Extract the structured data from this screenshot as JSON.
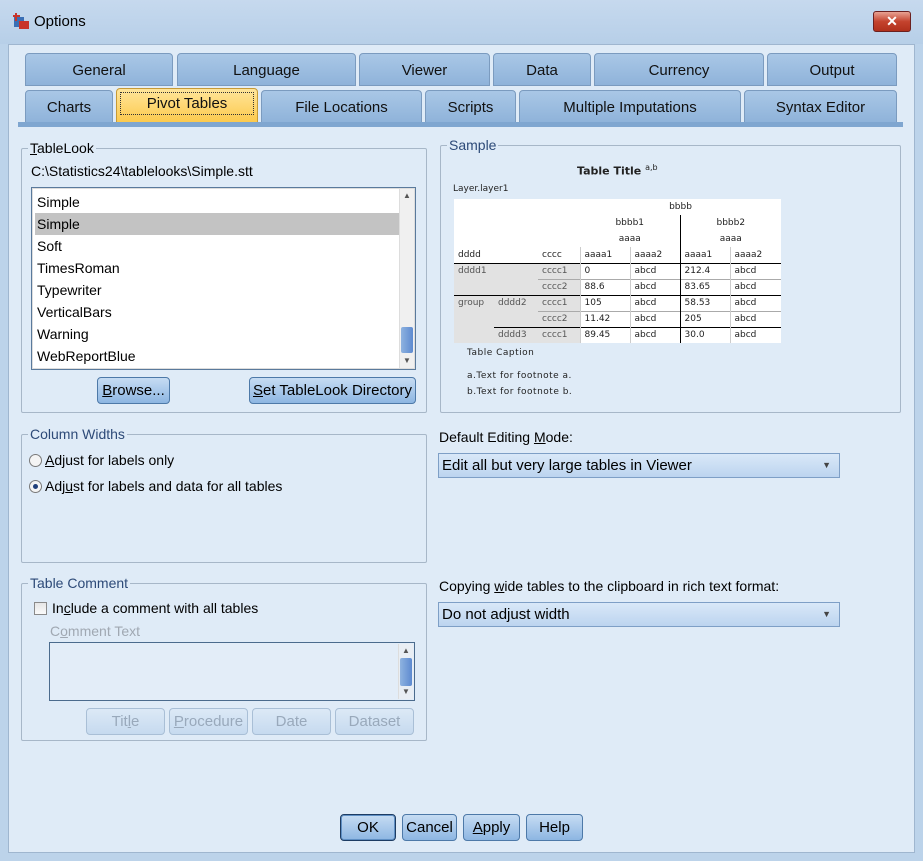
{
  "window": {
    "title": "Options",
    "close": "✕"
  },
  "tabs_row1": [
    "General",
    "Language",
    "Viewer",
    "Data",
    "Currency",
    "Output"
  ],
  "tabs_row2": [
    "Charts",
    "Pivot Tables",
    "File Locations",
    "Scripts",
    "Multiple Imputations",
    "Syntax Editor"
  ],
  "active_tab": "Pivot Tables",
  "tablelook": {
    "legend_pre": "",
    "legend_u": "T",
    "legend_post": "ableLook",
    "path": "C:\\Statistics24\\tablelooks\\Simple.stt",
    "items": [
      "Simple",
      "Simple",
      "Soft",
      "TimesRoman",
      "Typewriter",
      "VerticalBars",
      "Warning",
      "WebReportBlue"
    ],
    "selected_index": 1,
    "browse_u": "B",
    "browse_rest": "rowse...",
    "setdir_u": "S",
    "setdir_rest": "et TableLook Directory"
  },
  "sample": {
    "legend": "Sample",
    "title": "Table Title",
    "title_sup": "a,b",
    "layer": "Layer.layer1",
    "col_top": "bbbb",
    "col_b1": "bbbb1",
    "col_b2": "bbbb2",
    "col_a": "aaaa",
    "row_dim": "dddd",
    "row_sub": "cccc",
    "col_leaves": [
      "aaaa1",
      "aaaa2",
      "aaaa1",
      "aaaa2"
    ],
    "rows": [
      {
        "d1": "dddd1",
        "d2": "",
        "c": "cccc1",
        "v": [
          "0",
          "abcd",
          "212.4",
          "abcd"
        ]
      },
      {
        "d1": "",
        "d2": "",
        "c": "cccc2",
        "v": [
          "88.6",
          "abcd",
          "83.65",
          "abcd"
        ]
      },
      {
        "d1": "group",
        "d2": "dddd2",
        "c": "cccc1",
        "v": [
          "105",
          "abcd",
          "58.53",
          "abcd"
        ]
      },
      {
        "d1": "",
        "d2": "",
        "c": "cccc2",
        "v": [
          "11.42",
          "abcd",
          "205",
          "abcd"
        ]
      },
      {
        "d1": "",
        "d2": "dddd3",
        "c": "cccc1",
        "v": [
          "89.45",
          "abcd",
          "30.0",
          "abcd"
        ]
      }
    ],
    "caption": "Table Caption",
    "footnotes": [
      "a.Text for footnote a.",
      "b.Text for footnote b."
    ]
  },
  "column_widths": {
    "legend": "Column Widths",
    "opt1_pre": "",
    "opt1_u": "A",
    "opt1_post": "djust for labels only",
    "opt2_pre": "Adj",
    "opt2_u": "u",
    "opt2_post": "st for labels and data for all tables",
    "selected": 2
  },
  "editing": {
    "label_pre": "Default Editing ",
    "label_u": "M",
    "label_post": "ode:",
    "value": "Edit all but very large tables in Viewer"
  },
  "copying": {
    "label_pre": "Copying ",
    "label_u": "w",
    "label_post": "ide tables to the clipboard in rich text format:",
    "value": "Do not adjust width"
  },
  "table_comment": {
    "legend": "Table Comment",
    "check_pre": "In",
    "check_u": "c",
    "check_post": "lude a comment with all tables",
    "checked": false,
    "text_label_pre": "C",
    "text_label_u": "o",
    "text_label_post": "mment Text",
    "comment_value": "",
    "btn_title_pre": "Tit",
    "btn_title_u": "l",
    "btn_title_post": "e",
    "btn_proc_u": "P",
    "btn_proc_post": "rocedure",
    "btn_date": "Date",
    "btn_dataset": "Dataset"
  },
  "footer": {
    "ok": "OK",
    "cancel": "Cancel",
    "apply_u": "A",
    "apply_post": "pply",
    "help": "Help"
  }
}
